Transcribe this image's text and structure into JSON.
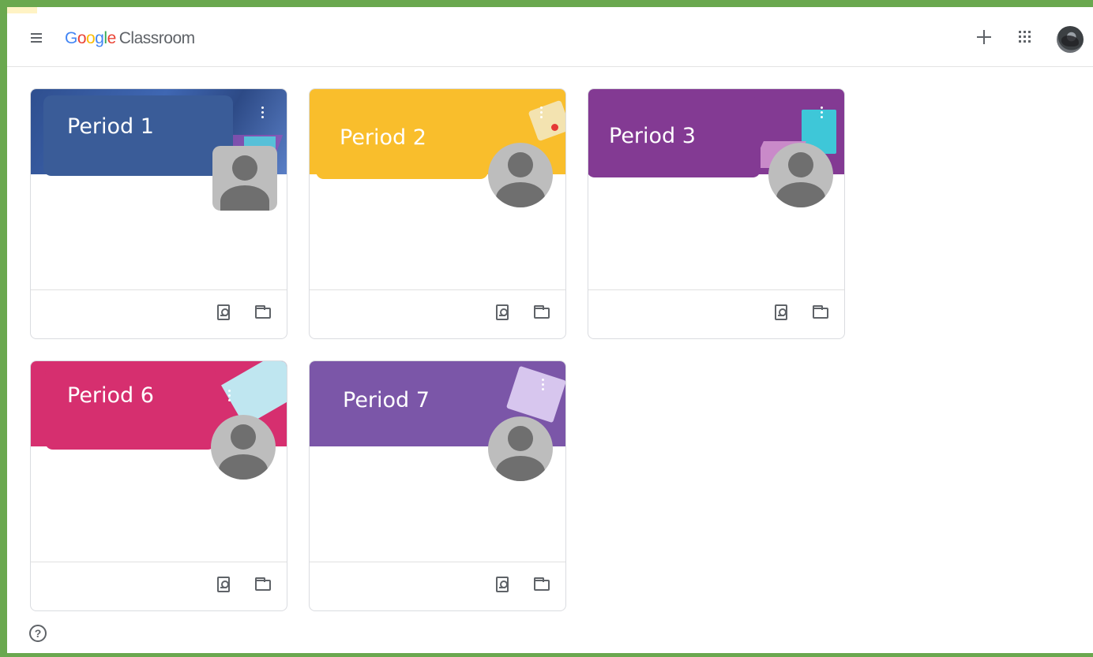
{
  "app": {
    "brand_google": "Google",
    "brand_product": "Classroom"
  },
  "icons": {
    "menu": "menu-icon",
    "create": "plus-icon",
    "apps": "apps-grid-icon",
    "account": "account-avatar",
    "assignments": "assignment-icon",
    "folder": "folder-icon",
    "help": "help-icon"
  },
  "colors": {
    "google_blue": "#4285f4",
    "google_red": "#ea4335",
    "google_yellow": "#fbbc05",
    "google_green": "#34a853",
    "period1": "#3a5c98",
    "period2": "#f9be2c",
    "period3": "#833a93",
    "period6": "#d62f6f",
    "period7": "#7b56a8"
  },
  "classes": [
    {
      "name": "Period 1"
    },
    {
      "name": "Period 2"
    },
    {
      "name": "Period 3"
    },
    {
      "name": "Period 6"
    },
    {
      "name": "Period 7"
    }
  ],
  "help_symbol": "?"
}
